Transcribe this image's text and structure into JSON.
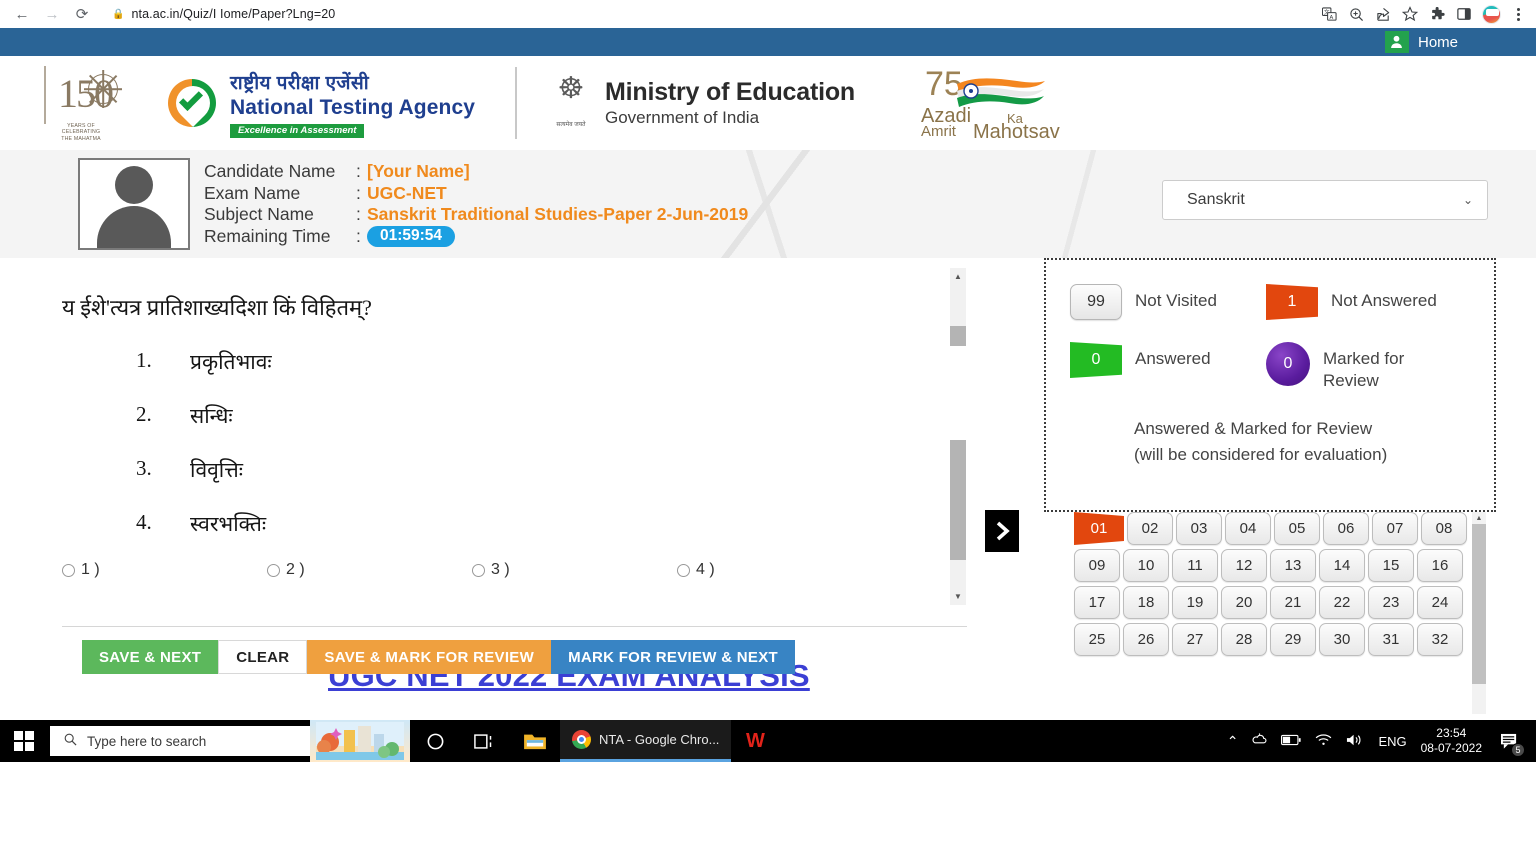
{
  "browser": {
    "url": "nta.ac.in/Quiz/I Iome/Paper?Lng=20",
    "back_icon": "back-arrow-icon",
    "forward_icon": "forward-arrow-icon",
    "reload_icon": "reload-icon",
    "lock_icon": "lock-icon",
    "toolbar_icons": [
      "translate-icon",
      "zoom-icon",
      "share-icon",
      "bookmark-star-icon",
      "extensions-puzzle-icon",
      "sidebar-panel-icon",
      "profile-avatar-icon",
      "chrome-menu-icon"
    ]
  },
  "topbar": {
    "home_label": "Home",
    "home_icon": "user-person-icon",
    "bar_color": "#2a6496"
  },
  "logos": {
    "anniversary": {
      "number": "150",
      "caption": "YEARS OF\nCELEBRATING\nTHE MAHATMA"
    },
    "nta": {
      "hindi": "राष्ट्रीय परीक्षा एजेंसी",
      "english": "National Testing Agency",
      "tagline": "Excellence in Assessment"
    },
    "ministry": {
      "title": "Ministry of Education",
      "subtitle": "Government of India",
      "motto": "सत्यमेव जयते",
      "emblem_icon": "ashoka-emblem-icon"
    },
    "azadi": {
      "num": "75",
      "line1": "Azadi",
      "line2": "Ka",
      "line3": "Amrit",
      "line4": "Mahotsav",
      "flag_icon": "indian-tricolour-flag-icon"
    }
  },
  "candidate": {
    "labels": {
      "name": "Candidate Name",
      "exam": "Exam Name",
      "subject": "Subject Name",
      "time": "Remaining Time"
    },
    "colon": ":",
    "name": "[Your Name]",
    "exam": "UGC-NET",
    "subject": "Sanskrit Traditional Studies-Paper 2-Jun-2019",
    "remaining_time": "01:59:54",
    "accent_color": "#f08a1d",
    "timer_bg": "#1ba0e2",
    "photo_icon": "candidate-photo-placeholder-icon"
  },
  "language": {
    "selected": "Sanskrit",
    "chevron_icon": "chevron-down-icon"
  },
  "question": {
    "text": "य ईशे'त्यत्र प्रातिशाख्यदिशा किं विहितम्?",
    "options": [
      {
        "num": "1.",
        "text": "प्रकृतिभावः"
      },
      {
        "num": "2.",
        "text": "सन्धिः"
      },
      {
        "num": "3.",
        "text": "विवृत्तिः"
      },
      {
        "num": "4.",
        "text": "स्वरभक्तिः"
      }
    ],
    "radio_labels": [
      "1 )",
      "2 )",
      "3 )",
      "4 )"
    ],
    "overlay_text": "UGC NET 2022 EXAM ANALYSIS",
    "overlay_color": "#3b3fd4"
  },
  "actions": {
    "save_next": "SAVE & NEXT",
    "clear": "CLEAR",
    "save_mark_review": "SAVE & MARK FOR REVIEW",
    "mark_review_next": "MARK FOR REVIEW & NEXT",
    "colors": {
      "save_next": "#5cb85c",
      "save_mark_review": "#efa03f",
      "mark_review_next": "#3884c4"
    }
  },
  "panel_toggle": {
    "icon": "chevron-right-icon"
  },
  "legend": {
    "items": [
      {
        "count": "99",
        "label": "Not Visited",
        "style": "grey",
        "color": "#e8e8e8"
      },
      {
        "count": "1",
        "label": "Not Answered",
        "style": "orange",
        "color": "#e2470e"
      },
      {
        "count": "0",
        "label": "Answered",
        "style": "green",
        "color": "#23bb23"
      },
      {
        "count": "0",
        "label": "Marked for Review",
        "style": "purple",
        "color": "#5a1c9e"
      }
    ],
    "note_line1": "Answered & Marked for Review",
    "note_line2": "(will be considered for evaluation)"
  },
  "palette": {
    "current": "01",
    "numbers": [
      "01",
      "02",
      "03",
      "04",
      "05",
      "06",
      "07",
      "08",
      "09",
      "10",
      "11",
      "12",
      "13",
      "14",
      "15",
      "16",
      "17",
      "18",
      "19",
      "20",
      "21",
      "22",
      "23",
      "24",
      "25",
      "26",
      "27",
      "28",
      "29",
      "30",
      "31",
      "32"
    ],
    "scroll_up_icon": "scroll-up-arrow-icon"
  },
  "taskbar": {
    "start_icon": "windows-start-icon",
    "search_placeholder": "Type here to search",
    "search_icon": "search-magnifier-icon",
    "widget_icon": "news-weather-widget-icon",
    "cortana_icon": "cortana-circle-icon",
    "taskview_icon": "task-view-icon",
    "explorer_icon": "file-explorer-icon",
    "active_window": "NTA - Google Chro...",
    "chrome_icon": "chrome-icon",
    "wps_icon": "wps-office-icon",
    "tray_icons": [
      "chevron-up-icon",
      "onedrive-icon",
      "battery-icon",
      "wifi-icon",
      "volume-icon"
    ],
    "language": "ENG",
    "time": "23:54",
    "date": "08-07-2022",
    "notification_icon": "notifications-icon",
    "notification_count": "5"
  }
}
